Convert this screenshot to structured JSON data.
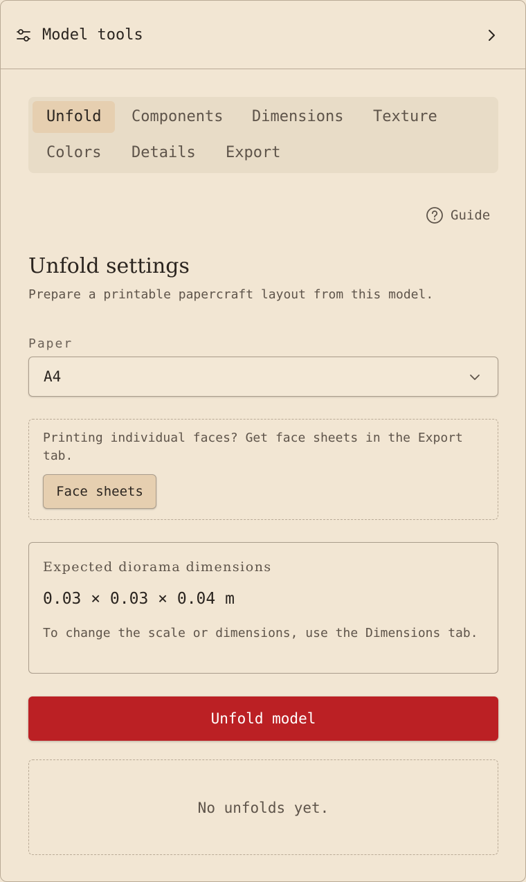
{
  "header": {
    "title": "Model tools",
    "icon": "sliders-icon",
    "action_icon": "chevron-right-icon"
  },
  "tabs": [
    {
      "label": "Unfold",
      "active": true
    },
    {
      "label": "Components",
      "active": false
    },
    {
      "label": "Dimensions",
      "active": false
    },
    {
      "label": "Texture",
      "active": false
    },
    {
      "label": "Colors",
      "active": false
    },
    {
      "label": "Details",
      "active": false
    },
    {
      "label": "Export",
      "active": false
    }
  ],
  "guide": {
    "label": "Guide",
    "icon": "help-circle-icon"
  },
  "section": {
    "title": "Unfold settings",
    "subtitle": "Prepare a printable papercraft layout from this model."
  },
  "paper": {
    "label": "Paper",
    "value": "A4",
    "icon": "chevron-down-icon"
  },
  "notice": {
    "text": "Printing individual faces? Get face sheets in the Export tab.",
    "button_label": "Face sheets"
  },
  "dimensions": {
    "label": "Expected diorama dimensions",
    "value": "0.03 × 0.03 × 0.04 m",
    "note": "To change the scale or dimensions, use the Dimensions tab."
  },
  "unfold_button": {
    "label": "Unfold model"
  },
  "empty_state": {
    "text": "No unfolds yet."
  },
  "colors": {
    "background": "#f2e6d3",
    "tab_bar": "#e8dcc7",
    "tab_active": "#e6cfb0",
    "primary": "#bb2024",
    "border": "#b9aa96"
  }
}
